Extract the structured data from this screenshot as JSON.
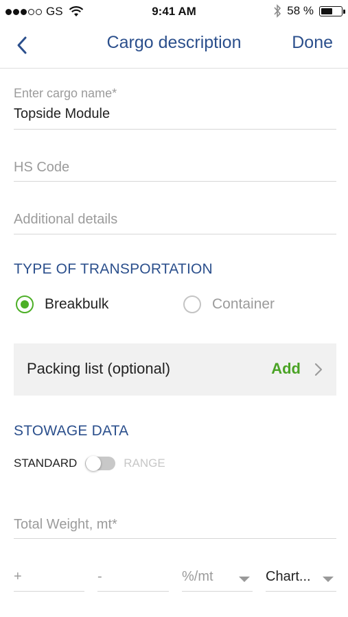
{
  "status_bar": {
    "carrier": "GS",
    "time": "9:41 AM",
    "battery": "58 %",
    "battery_level": 0.58
  },
  "nav": {
    "title": "Cargo description",
    "done_label": "Done"
  },
  "fields": {
    "cargo_name_label": "Enter cargo name*",
    "cargo_name_value": "Topside Module",
    "hs_code_placeholder": "HS Code",
    "details_placeholder": "Additional details"
  },
  "transport": {
    "section_title": "TYPE OF TRANSPORTATION",
    "options": [
      {
        "label": "Breakbulk",
        "selected": true
      },
      {
        "label": "Container",
        "selected": false
      }
    ]
  },
  "packing": {
    "label": "Packing list (optional)",
    "action": "Add"
  },
  "stowage": {
    "section_title": "STOWAGE DATA",
    "toggle_left": "STANDARD",
    "toggle_right": "RANGE",
    "toggle_on": false,
    "total_weight_placeholder": "Total Weight, mt*",
    "plus_placeholder": "+",
    "minus_placeholder": "-",
    "unit_selected": "%/mt",
    "chart_selected": "Chart..."
  },
  "colors": {
    "accent": "#2b4f8c",
    "success": "#4caf26"
  }
}
